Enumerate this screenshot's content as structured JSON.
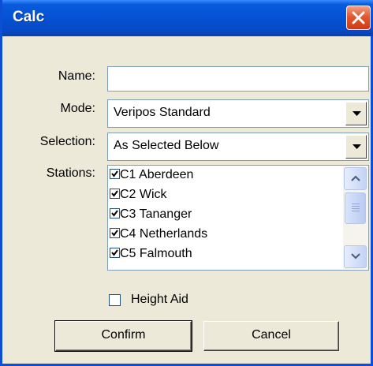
{
  "window": {
    "title": "Calc"
  },
  "form": {
    "name_label": "Name:",
    "name_value": "",
    "mode_label": "Mode:",
    "mode_value": "Veripos Standard",
    "selection_label": "Selection:",
    "selection_value": "As Selected Below",
    "stations_label": "Stations:"
  },
  "stations": [
    {
      "label": "C1  Aberdeen",
      "checked": true
    },
    {
      "label": "C2 Wick",
      "checked": true
    },
    {
      "label": "C3 Tananger",
      "checked": true
    },
    {
      "label": "C4 Netherlands",
      "checked": true
    },
    {
      "label": "C5 Falmouth",
      "checked": true
    }
  ],
  "height_aid": {
    "label": "Height Aid",
    "checked": false
  },
  "buttons": {
    "confirm": "Confirm",
    "cancel": "Cancel"
  },
  "icons": {
    "close": "close-icon",
    "dropdown": "chevron-down-icon",
    "scroll_up": "scroll-up-icon",
    "scroll_down": "scroll-down-icon",
    "check": "check-icon"
  },
  "colors": {
    "titlebar": "#0553d6",
    "close": "#e5572e",
    "background": "#ece9d8",
    "field_border": "#7f9db9"
  }
}
